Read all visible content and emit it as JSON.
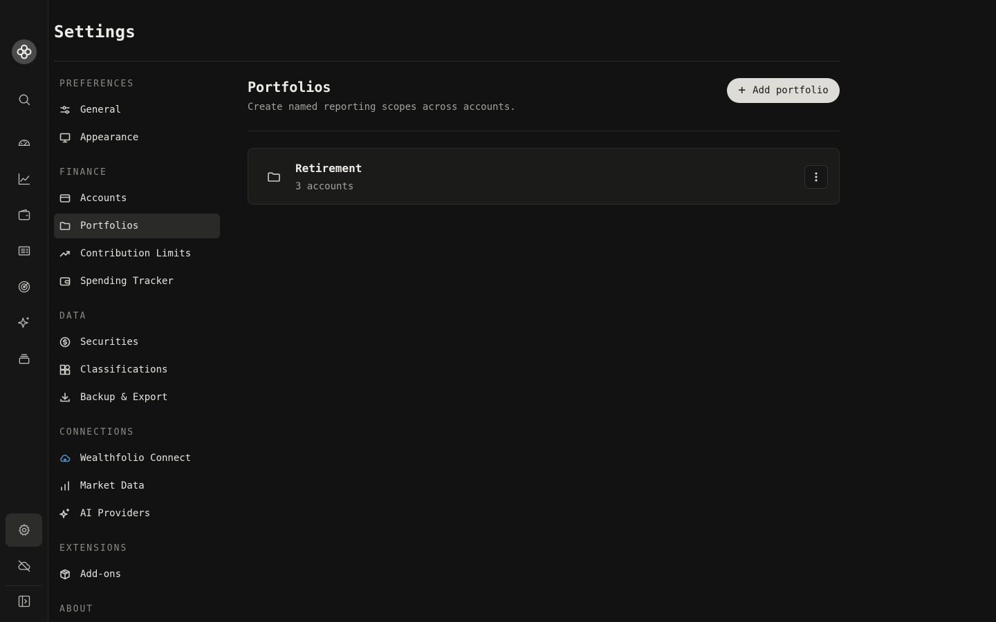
{
  "page": {
    "title": "Settings"
  },
  "rail": {
    "items": [
      "logo",
      "search",
      "dashboard",
      "performance",
      "wallet",
      "activity",
      "goals",
      "ai",
      "stack",
      "settings",
      "sync-off",
      "toggle-sidebar"
    ]
  },
  "nav": {
    "sections": [
      {
        "title": "PREFERENCES",
        "items": [
          {
            "label": "General",
            "icon": "sliders-icon"
          },
          {
            "label": "Appearance",
            "icon": "monitor-icon"
          }
        ]
      },
      {
        "title": "FINANCE",
        "items": [
          {
            "label": "Accounts",
            "icon": "credit-card-icon"
          },
          {
            "label": "Portfolios",
            "icon": "folder-icon",
            "active": true
          },
          {
            "label": "Contribution Limits",
            "icon": "trending-up-icon"
          },
          {
            "label": "Spending Tracker",
            "icon": "wallet-icon"
          }
        ]
      },
      {
        "title": "DATA",
        "items": [
          {
            "label": "Securities",
            "icon": "dollar-circle-icon"
          },
          {
            "label": "Classifications",
            "icon": "shapes-icon"
          },
          {
            "label": "Backup & Export",
            "icon": "download-icon"
          }
        ]
      },
      {
        "title": "CONNECTIONS",
        "items": [
          {
            "label": "Wealthfolio Connect",
            "icon": "cloud-icon"
          },
          {
            "label": "Market Data",
            "icon": "bar-chart-icon"
          },
          {
            "label": "AI Providers",
            "icon": "sparkles-icon"
          }
        ]
      },
      {
        "title": "EXTENSIONS",
        "items": [
          {
            "label": "Add-ons",
            "icon": "package-icon"
          }
        ]
      },
      {
        "title": "ABOUT",
        "items": []
      }
    ]
  },
  "main": {
    "title": "Portfolios",
    "subtitle": "Create named reporting scopes across accounts.",
    "add_button": "Add portfolio",
    "portfolios": [
      {
        "name": "Retirement",
        "count": "3 accounts"
      }
    ]
  },
  "colors": {
    "background": "#121212",
    "accent_cloud": "#4a8fc7",
    "button_bg": "#dedcd6"
  }
}
